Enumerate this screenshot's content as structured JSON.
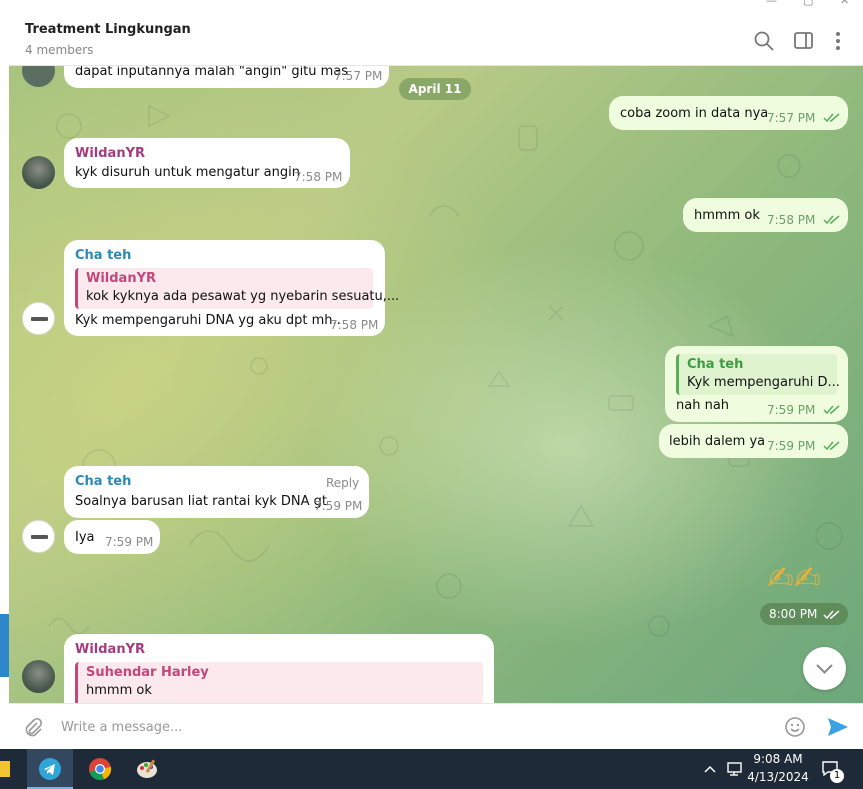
{
  "header": {
    "title": "Treatment Lingkungan",
    "members": "4 members"
  },
  "date_separator": "April 11",
  "messages": {
    "m0": {
      "text": "dapat inputannya malah \"angin\" gitu mas",
      "time": "7:57 PM"
    },
    "m1": {
      "text": "coba zoom in data nya",
      "time": "7:57 PM"
    },
    "m2": {
      "sender": "WildanYR",
      "text": "kyk disuruh untuk mengatur angin",
      "time": "7:58 PM"
    },
    "m3": {
      "text": "hmmm ok",
      "time": "7:58 PM"
    },
    "m4": {
      "sender": "Cha teh",
      "quote_name": "WildanYR",
      "quote_text": "kok kyknya ada pesawat yg nyebarin sesuatu,...",
      "text": "Kyk mempengaruhi DNA yg aku dpt mh..",
      "time": "7:58 PM"
    },
    "m5": {
      "quote_name": "Cha teh",
      "quote_text": "Kyk mempengaruhi D...",
      "text": "nah nah",
      "time": "7:59 PM"
    },
    "m6": {
      "text": "lebih dalem ya",
      "time": "7:59 PM"
    },
    "m7": {
      "sender": "Cha teh",
      "reply_label": "Reply",
      "text": "Soalnya barusan liat rantai kyk DNA gt",
      "time": "7:59 PM"
    },
    "m8": {
      "text": "Iya",
      "time": "7:59 PM"
    },
    "m9": {
      "emoji": "✍✍",
      "time": "8:00 PM"
    },
    "m10": {
      "sender": "WildanYR",
      "quote_name": "Suhendar Harley",
      "quote_text": "hmmm ok"
    }
  },
  "composer": {
    "placeholder": "Write a message..."
  },
  "taskbar": {
    "time": "9:08 AM",
    "date": "4/13/2024",
    "notification_count": "1"
  },
  "colors": {
    "wildan": "#a23b7d",
    "chateh": "#2a8bb5",
    "quote_wildan": "#c4467a",
    "quote_cha": "#3f9b3f",
    "accent": "#3ba1e0"
  },
  "icons": [
    "search-icon",
    "sidebar-toggle-icon",
    "more-vertical-icon",
    "attach-icon",
    "emoji-icon",
    "send-icon",
    "chevron-down-icon",
    "telegram-icon",
    "chrome-icon",
    "paint-icon"
  ]
}
